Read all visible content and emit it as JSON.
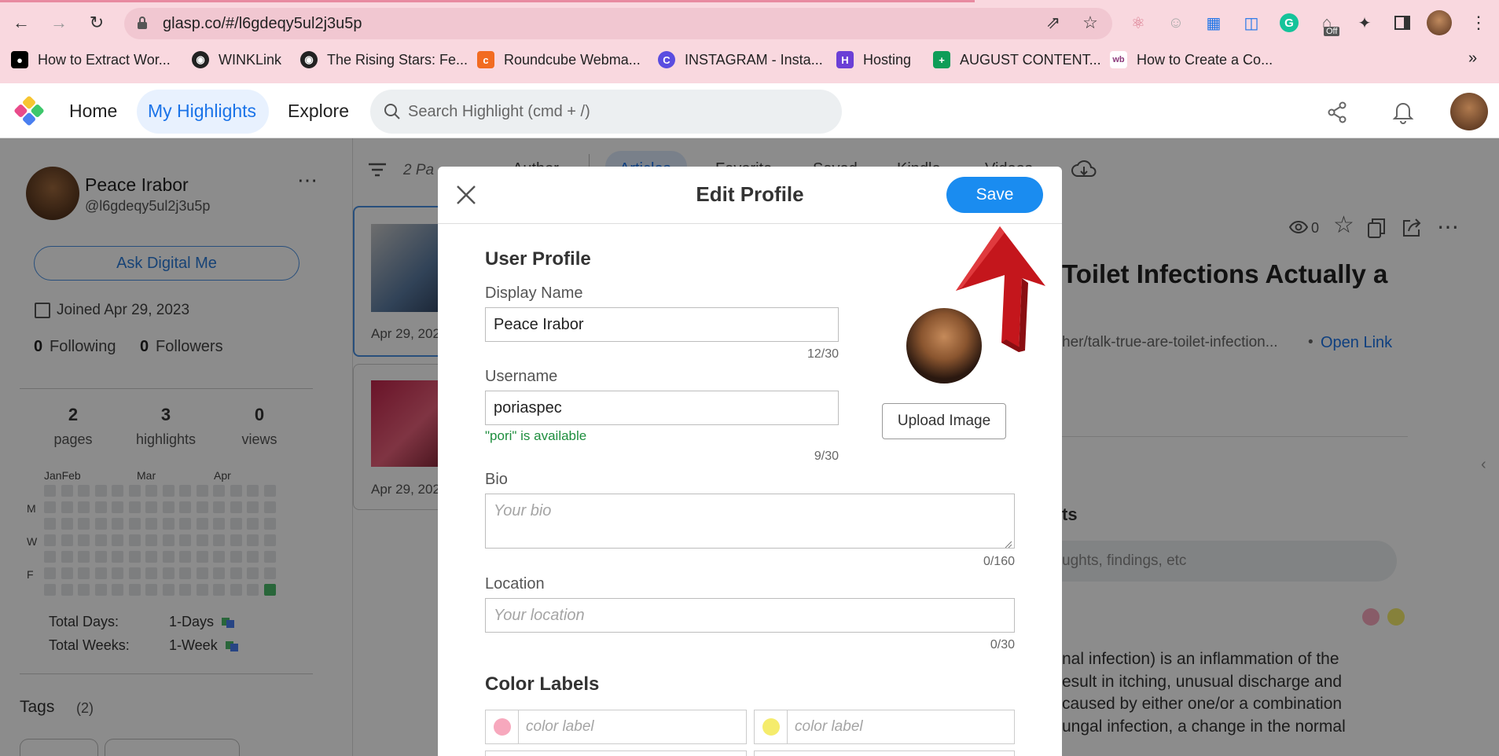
{
  "browser": {
    "url": "glasp.co/#/l6gdeqy5ul2j3u5p"
  },
  "bookmarks": [
    "How to Extract Wor...",
    "WINKLink",
    "The Rising Stars: Fe...",
    "Roundcube Webma...",
    "INSTAGRAM - Insta...",
    "Hosting",
    "AUGUST CONTENT...",
    "How to Create a Co..."
  ],
  "extension": {
    "off_badge": "Off"
  },
  "nav": {
    "home": "Home",
    "highlights": "My Highlights",
    "explore": "Explore",
    "search_placeholder": "Search Highlight (cmd + /)"
  },
  "profile": {
    "name": "Peace Irabor",
    "handle": "@l6gdeqy5ul2j3u5p",
    "ask_button": "Ask Digital Me",
    "joined": "Joined Apr 29, 2023",
    "following_count": "0",
    "following_label": "Following",
    "followers_count": "0",
    "followers_label": "Followers",
    "pages_count": "2",
    "pages_label": "pages",
    "highlights_count": "3",
    "highlights_label": "highlights",
    "views_count": "0",
    "views_label": "views",
    "months": [
      "JanFeb",
      "Mar",
      "Apr"
    ],
    "days": [
      "M",
      "W",
      "F"
    ],
    "total_days_label": "Total Days:",
    "total_days_value": "1-Days",
    "total_weeks_label": "Total Weeks:",
    "total_weeks_value": "1-Week",
    "tags_label": "Tags",
    "tags_count": "(2)"
  },
  "filters": {
    "count": "2 Pa",
    "tabs": [
      "Author",
      "Articles",
      "Favorite",
      "Saved",
      "Kindle",
      "Videos"
    ]
  },
  "cards": [
    {
      "date": "Apr 29, 202"
    },
    {
      "date": "Apr 29, 202"
    }
  ],
  "article": {
    "views": "0",
    "title": "Toilet Infections Actually a",
    "url": "her/talk-true-are-toilet-infection...",
    "bullet": "•",
    "open_link": "Open Link",
    "notes_heading": "ts",
    "notes_placeholder": "ughts, findings, etc",
    "body_lines": [
      "nal infection) is an inflammation of the",
      "esult in itching, unusual discharge and",
      "caused by either one/or a combination",
      "ungal infection, a change in the normal"
    ]
  },
  "modal": {
    "title": "Edit Profile",
    "save": "Save",
    "section": "User Profile",
    "display_name_label": "Display Name",
    "display_name_value": "Peace Irabor",
    "display_name_counter": "12/30",
    "username_label": "Username",
    "username_value": "poriaspec",
    "username_status": "\"pori\" is available",
    "username_counter": "9/30",
    "upload_button": "Upload Image",
    "bio_label": "Bio",
    "bio_placeholder": "Your bio",
    "bio_counter": "0/160",
    "location_label": "Location",
    "location_placeholder": "Your location",
    "location_counter": "0/30",
    "color_labels_heading": "Color Labels",
    "color_label_placeholder": "color label"
  },
  "colors": {
    "accent": "#1a8cf0",
    "available": "#1e8e3e",
    "pink_label": "#f7a8bd",
    "yellow_label": "#f5ec6c",
    "arrow": "#c4161c",
    "activity": "#4cbb6a"
  }
}
